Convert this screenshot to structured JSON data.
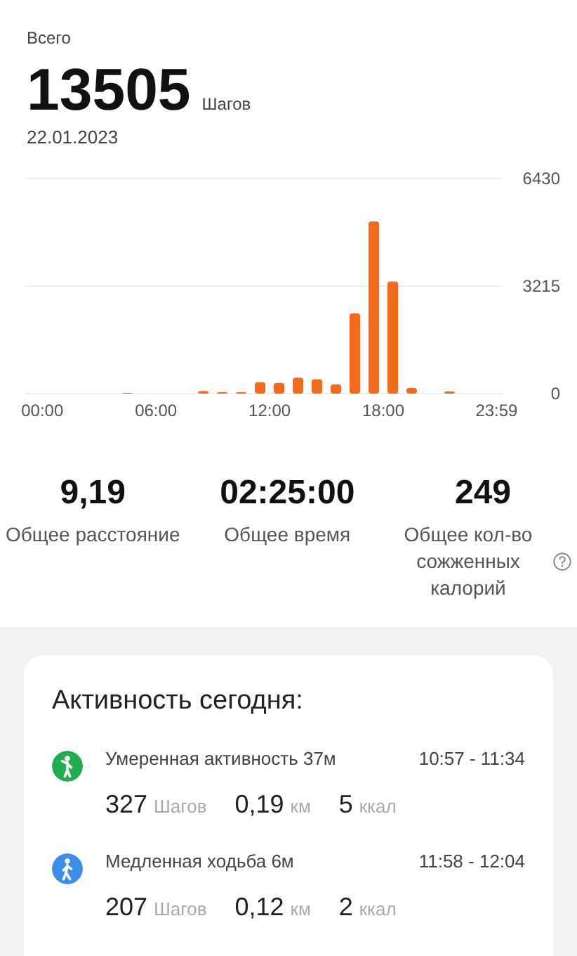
{
  "header": {
    "label": "Всего",
    "steps": "13505",
    "steps_unit": "Шагов",
    "date": "22.01.2023"
  },
  "steps_chart": {
    "chart_data": {
      "type": "bar",
      "x": [
        4.5,
        8.5,
        9.5,
        10.5,
        11.5,
        12.5,
        13.5,
        14.5,
        15.5,
        16.5,
        17.5,
        18.5,
        19.5,
        21.5
      ],
      "series": [
        {
          "color": "#f26b1d",
          "values": [
            20,
            80,
            40,
            40,
            340,
            320,
            480,
            430,
            280,
            2400,
            5150,
            3350,
            170,
            70
          ]
        }
      ],
      "xlim": [
        -0.9,
        24.3
      ],
      "ylim": [
        0,
        6430
      ],
      "yticks": [
        0,
        3215,
        6430
      ],
      "xticks": [
        {
          "value": 0,
          "label": "00:00"
        },
        {
          "value": 6,
          "label": "06:00"
        },
        {
          "value": 12,
          "label": "12:00"
        },
        {
          "value": 18,
          "label": "18:00"
        },
        {
          "value": 23.983,
          "label": "23:59"
        }
      ]
    }
  },
  "totals": [
    {
      "value": "9,19",
      "label": "Общее расстояние",
      "help": false
    },
    {
      "value": "02:25:00",
      "label": "Общее время",
      "help": false
    },
    {
      "value": "249",
      "label": "Общее кол-во сожженных калорий",
      "help": true
    }
  ],
  "activity": {
    "title": "Активность сегодня:",
    "items": [
      {
        "kind": "moderate",
        "color": "#1fad4f",
        "name": "Умеренная активность 37м",
        "time": "10:57 - 11:34",
        "steps": "327",
        "steps_unit": "Шагов",
        "distance": "0,19",
        "distance_unit": "км",
        "calories": "5",
        "calories_unit": "ккал"
      },
      {
        "kind": "walk",
        "color": "#3b8ee8",
        "name": "Медленная ходьба 6м",
        "time": "11:58 - 12:04",
        "steps": "207",
        "steps_unit": "Шагов",
        "distance": "0,12",
        "distance_unit": "км",
        "calories": "2",
        "calories_unit": "ккал"
      }
    ]
  }
}
